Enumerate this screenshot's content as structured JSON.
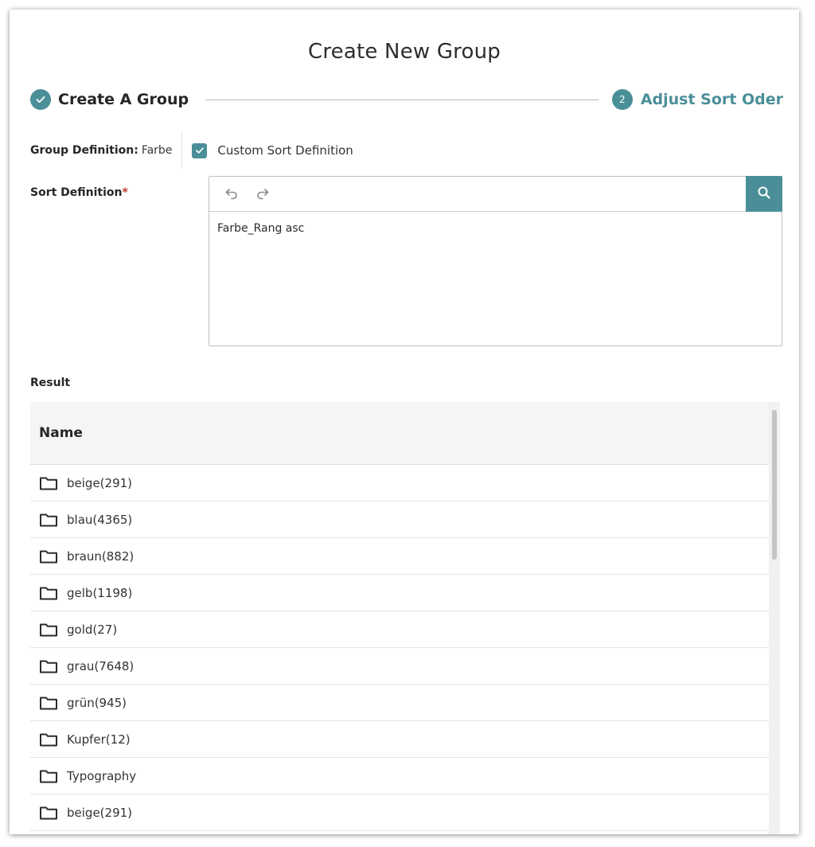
{
  "dialog": {
    "title": "Create New Group"
  },
  "stepper": {
    "step1": {
      "label": "Create A Group",
      "state": "completed",
      "icon": "check-icon"
    },
    "step2": {
      "number": "2",
      "label": "Adjust Sort Oder",
      "state": "active"
    },
    "accent_color": "#4a8f98"
  },
  "group_definition": {
    "label": "Group Definition:",
    "value": "Farbe",
    "custom_sort": {
      "label": "Custom Sort Definition",
      "checked": true
    }
  },
  "sort_definition": {
    "label": "Sort Definition",
    "required_marker": "*",
    "toolbar": {
      "undo_icon": "undo-icon",
      "redo_icon": "redo-icon",
      "search_icon": "search-icon"
    },
    "text": "Farbe_Rang asc"
  },
  "result": {
    "label": "Result",
    "column_header": "Name",
    "rows": [
      {
        "label": "beige(291)",
        "icon": "folder-icon"
      },
      {
        "label": "blau(4365)",
        "icon": "folder-icon"
      },
      {
        "label": "braun(882)",
        "icon": "folder-icon"
      },
      {
        "label": "gelb(1198)",
        "icon": "folder-icon"
      },
      {
        "label": "gold(27)",
        "icon": "folder-icon"
      },
      {
        "label": "grau(7648)",
        "icon": "folder-icon"
      },
      {
        "label": "grün(945)",
        "icon": "folder-icon"
      },
      {
        "label": "Kupfer(12)",
        "icon": "folder-icon"
      },
      {
        "label": "Typography",
        "icon": "folder-icon"
      },
      {
        "label": "beige(291)",
        "icon": "folder-icon"
      }
    ]
  }
}
